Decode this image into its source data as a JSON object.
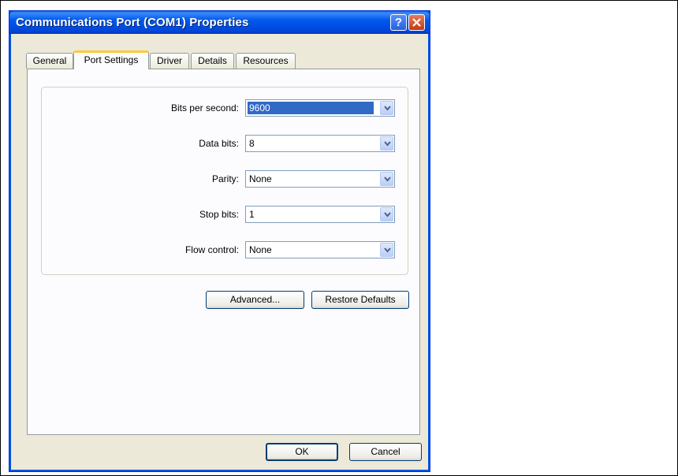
{
  "window": {
    "title": "Communications Port (COM1) Properties",
    "help_label": "?"
  },
  "tabs": [
    {
      "label": "General"
    },
    {
      "label": "Port Settings"
    },
    {
      "label": "Driver"
    },
    {
      "label": "Details"
    },
    {
      "label": "Resources"
    }
  ],
  "settings": {
    "bits_per_second": {
      "label": "Bits per second:",
      "value": "9600"
    },
    "data_bits": {
      "label": "Data bits:",
      "value": "8"
    },
    "parity": {
      "label": "Parity:",
      "value": "None"
    },
    "stop_bits": {
      "label": "Stop bits:",
      "value": "1"
    },
    "flow_control": {
      "label": "Flow control:",
      "value": "None"
    }
  },
  "buttons": {
    "advanced": "Advanced...",
    "restore_defaults": "Restore Defaults",
    "ok": "OK",
    "cancel": "Cancel"
  },
  "colors": {
    "titlebar": "#0058ee",
    "selection": "#316ac5",
    "active_tab_accent": "#ffc83c",
    "dialog_bg": "#ece9d8"
  }
}
